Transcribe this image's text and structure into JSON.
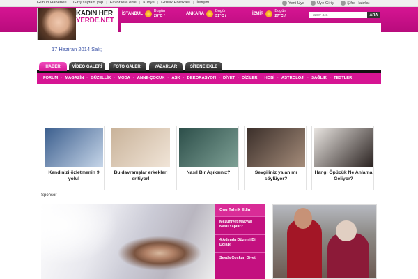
{
  "topbar": {
    "links": [
      "Günün Haberleri",
      "Giriş sayfam yap",
      "Favorilere ekle",
      "Künye",
      "Gizlilik Politikası",
      "İletişim"
    ],
    "user_links": [
      {
        "label": "Yeni Üye",
        "icon": "user-icon"
      },
      {
        "label": "Üye Girişi",
        "icon": "key-icon"
      },
      {
        "label": "Şifre Hatırlat",
        "icon": "lock-icon"
      }
    ]
  },
  "logo": {
    "line1": "KADIN HER",
    "line2": "YERDE.NET"
  },
  "weather": [
    {
      "city": "İSTANBUL",
      "day": "Bugün",
      "temp": "28°C /"
    },
    {
      "city": "ANKARA",
      "day": "Bugün",
      "temp": "31°C /"
    },
    {
      "city": "İZMİR",
      "day": "Bugün",
      "temp": "27°C /"
    }
  ],
  "search": {
    "placeholder": "Haber ara",
    "button": "ARA"
  },
  "date": "17 Haziran 2014 Salı;",
  "tabs": [
    "HABER",
    "VİDEO GALERİ",
    "FOTO GALERİ",
    "YAZARLAR",
    "SİTENE EKLE"
  ],
  "nav": [
    "FORUM",
    "MAGAZİN",
    "GÜZELLİK",
    "MODA",
    "ANNE-ÇOCUK",
    "AŞK",
    "DEKORASYON",
    "DİYET",
    "DİZİLER",
    "HOBİ",
    "ASTROLOJİ",
    "SAĞLIK",
    "TESTLER"
  ],
  "cards": [
    {
      "caption": "Kendinizi özletmenin 9 yolu!",
      "colors": [
        "#3c5f8e",
        "#c7d6e9"
      ]
    },
    {
      "caption": "Bu davranışlar erkekleri eritiyor!",
      "colors": [
        "#c9b39a",
        "#f1e5d8"
      ]
    },
    {
      "caption": "Nasıl Bir Aşıksınız?",
      "colors": [
        "#2d4f4a",
        "#7ea095"
      ]
    },
    {
      "caption": "Sevgiliniz yalan mı söylüyor?",
      "colors": [
        "#3b2f2a",
        "#a58c7a"
      ]
    },
    {
      "caption": "Hangi Öpücük Ne Anlama Geliyor?",
      "colors": [
        "#e8e4e0",
        "#2a2220"
      ]
    }
  ],
  "sponsor": "Sponsor",
  "side_panel": {
    "head": "Onu Tahrik Edin!",
    "items": [
      "Mezuniyet Makyajı Nasıl Yapılır?",
      "4 Adımda Düzenli Bir Dolap!",
      "Şeyda Coşkun Diyeti"
    ]
  }
}
